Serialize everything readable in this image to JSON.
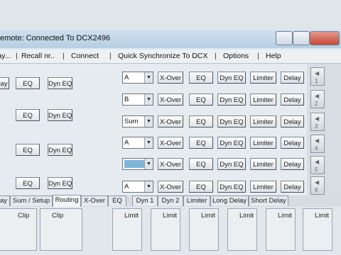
{
  "window": {
    "title": "emote: Connected To DCX2496"
  },
  "menu": [
    "lay...",
    "Recall nr..",
    "Connect",
    "Quick Synchronize To DCX",
    "Options",
    "Help"
  ],
  "inputs": [
    {
      "delay": "lay",
      "eq": "EQ",
      "dyn_eq": "Dyn EQ"
    },
    {
      "eq": "EQ",
      "dyn_eq": "Dyn EQ"
    },
    {
      "eq": "EQ",
      "dyn_eq": "Dyn EQ"
    },
    {
      "eq": "EQ",
      "dyn_eq": "Dyn EQ"
    }
  ],
  "outputs": [
    {
      "source": "A",
      "xover": "X-Over",
      "eq": "EQ",
      "dyn_eq": "Dyn EQ",
      "limiter": "Limiter",
      "delay": "Delay",
      "num": "1"
    },
    {
      "source": "B",
      "xover": "X-Over",
      "eq": "EQ",
      "dyn_eq": "Dyn EQ",
      "limiter": "Limiter",
      "delay": "Delay",
      "num": "2"
    },
    {
      "source": "Sum",
      "xover": "X-Over",
      "eq": "EQ",
      "dyn_eq": "Dyn EQ",
      "limiter": "Limiter",
      "delay": "Delay",
      "num": "3"
    },
    {
      "source": "A",
      "xover": "X-Over",
      "eq": "EQ",
      "dyn_eq": "Dyn EQ",
      "limiter": "Limiter",
      "delay": "Delay",
      "num": "4"
    },
    {
      "source": "",
      "xover": "X-Over",
      "eq": "EQ",
      "dyn_eq": "Dyn EQ",
      "limiter": "Limiter",
      "delay": "Delay",
      "num": "5"
    },
    {
      "source": "A",
      "xover": "X-Over",
      "eq": "EQ",
      "dyn_eq": "Dyn EQ",
      "limiter": "Limiter",
      "delay": "Delay",
      "num": "6"
    }
  ],
  "tabs": [
    "ay",
    "Sum / Setup",
    "Routing",
    "X-Over",
    "EQ",
    "Dyn 1",
    "Dyn 2",
    "Limiter",
    "Long Delay",
    "Short Delay"
  ],
  "active_tab": "Routing",
  "bottom": {
    "clip1": "Clip",
    "clip2": "Clip",
    "limit_labels": [
      "Limit",
      "Limit",
      "Limit",
      "Limit",
      "Limit",
      "Limit"
    ]
  },
  "colors": {
    "red": "#c81818",
    "yellow": "#e8d84a",
    "green": "#2e8a2e",
    "blue": "#2a5bd0"
  }
}
